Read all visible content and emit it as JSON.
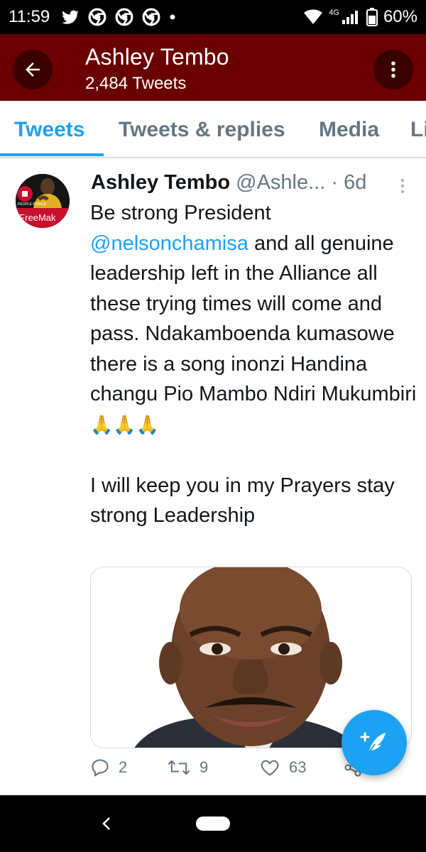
{
  "status_bar": {
    "time": "11:59",
    "battery_percent": "60%",
    "network": "4G",
    "icons": [
      "twitter-icon",
      "chrome-icon",
      "chrome-icon",
      "chrome-icon",
      "dot-icon",
      "wifi-icon",
      "signal-icon",
      "battery-icon"
    ]
  },
  "header": {
    "title": "Ashley Tembo",
    "subtitle": "2,484 Tweets",
    "background_color": "#6b0000"
  },
  "tabs": [
    {
      "label": "Tweets",
      "active": true
    },
    {
      "label": "Tweets & replies",
      "active": false
    },
    {
      "label": "Media",
      "active": false
    },
    {
      "label": "Li",
      "active": false
    }
  ],
  "tweet": {
    "author_name": "Ashley Tembo",
    "author_handle": "@Ashle...",
    "separator": "·",
    "time": "6d",
    "avatar_text": "#FreeMak",
    "avatar_badge": "PEOPLE POWER",
    "text_before_mention": "Be strong President ",
    "mention": "@nelsonchamisa",
    "text_after_mention": " and all genuine leadership left in the Alliance all these trying times will come and pass. Ndakamboenda kumasowe there is a song inonzi Handina changu Pio Mambo Ndiri Mukumbiri",
    "emojis": "🙏🙏🙏",
    "text_second_paragraph": "I will keep you in my Prayers stay strong Leadership",
    "counts": {
      "replies": "2",
      "retweets": "9",
      "likes": "63"
    }
  },
  "colors": {
    "accent": "#1da1f2",
    "header": "#6b0000",
    "muted": "#657786"
  }
}
